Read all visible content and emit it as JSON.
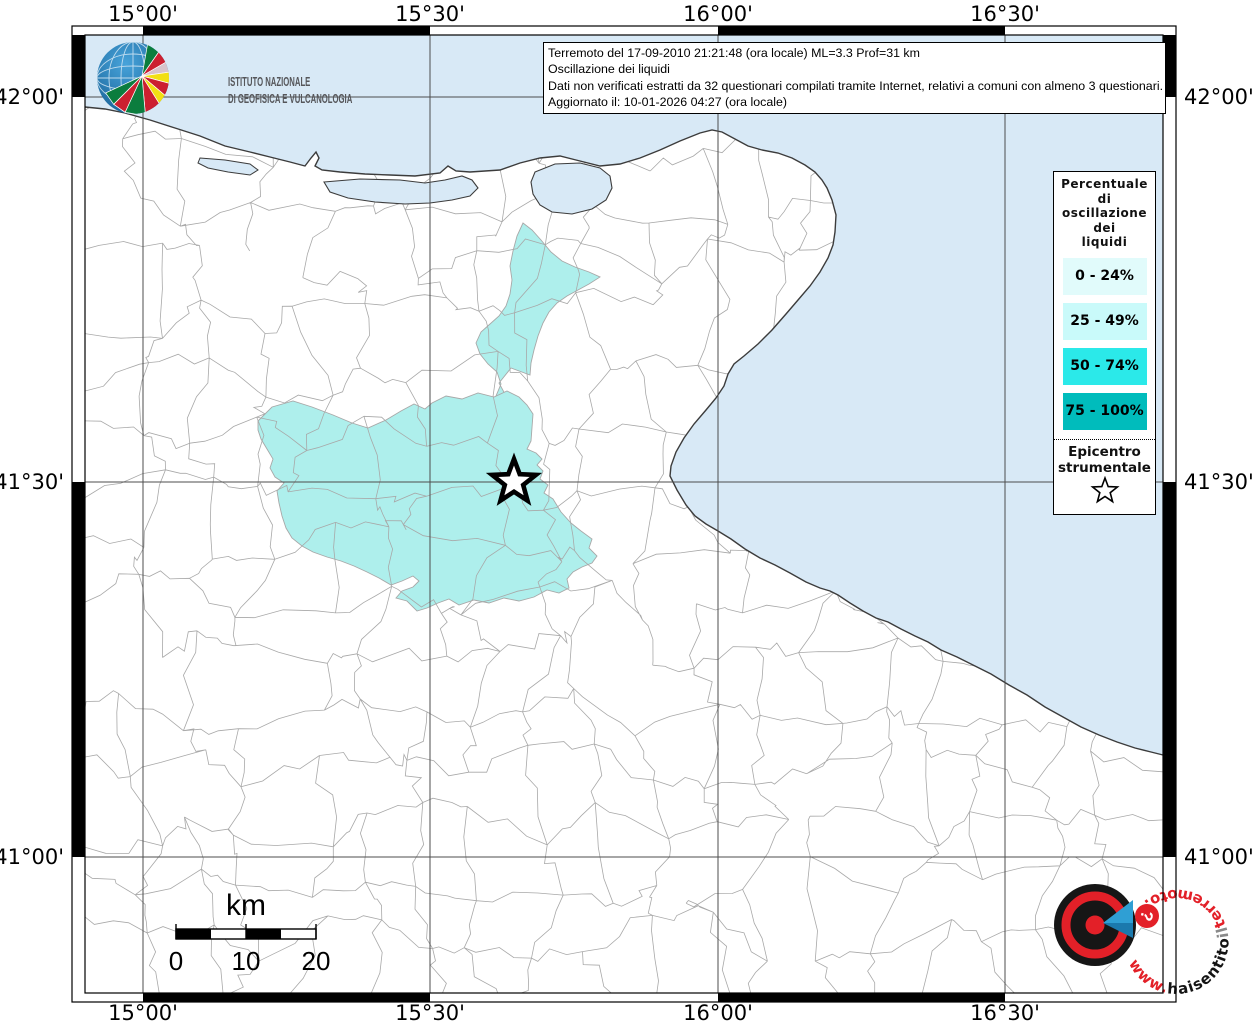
{
  "info_box": {
    "lines": [
      "Terremoto del 17-09-2010 21:21:48 (ora locale) ML=3.3 Prof=31 km",
      "Oscillazione dei liquidi",
      "Dati non verificati estratti da 32 questionari compilati tramite Internet, relativi a comuni con almeno 3 questionari.",
      "Aggiornato il: 10-01-2026 04:27 (ora locale)"
    ]
  },
  "ingv_logo": {
    "name_line1": "ISTITUTO NAZIONALE",
    "name_line2": "DI GEOFISICA E VULCANOLOGIA"
  },
  "axes": {
    "top": [
      "15°00'",
      "15°30'",
      "16°00'",
      "16°30'"
    ],
    "bottom": [
      "15°00'",
      "15°30'",
      "16°00'",
      "16°30'"
    ],
    "left": [
      "42°00'",
      "41°30'",
      "41°00'"
    ],
    "right": [
      "42°00'",
      "41°30'",
      "41°00'"
    ]
  },
  "legend": {
    "title_lines": [
      "Percentuale",
      "di",
      "oscillazione",
      "dei",
      "liquidi"
    ],
    "classes": [
      {
        "label": "0 - 24%",
        "color": "#E1FBFB"
      },
      {
        "label": "25 - 49%",
        "color": "#C9FAFA"
      },
      {
        "label": "50 - 74%",
        "color": "#2BE9E9"
      },
      {
        "label": "75 - 100%",
        "color": "#00BCBC"
      }
    ],
    "epicenter": {
      "line1": "Epicentro",
      "line2": "strumentale"
    }
  },
  "scale_bar": {
    "unit": "km",
    "tick_labels": [
      "0",
      "10",
      "20"
    ]
  },
  "site_logo": {
    "www": "www.",
    "haisentito": "haisentito",
    "il": "il",
    "terremoto": "terremoto.it",
    "question": "?"
  },
  "map_colors": {
    "sea": "#D8E9F6",
    "land": "#FFFFFF",
    "felt_region": "#AEEFEC",
    "municipality_border": "#A8A8A8",
    "coastline": "#3C3C3C"
  }
}
